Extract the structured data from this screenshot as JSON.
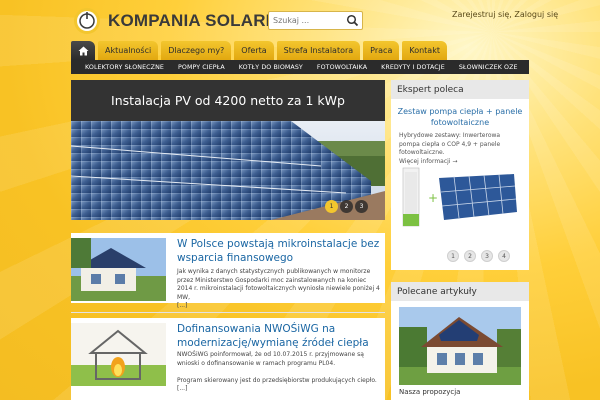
{
  "brand": {
    "name": "KOMPANIA SOLARNA",
    "accent": "#f3c62e"
  },
  "search": {
    "placeholder": "Szukaj ..."
  },
  "account": {
    "register": "Zarejestruj się,",
    "login": "Zaloguj się"
  },
  "nav": {
    "home_icon": "home-icon",
    "tabs": [
      "Aktualności",
      "Dlaczego my?",
      "Oferta",
      "Strefa Instalatora",
      "Praca",
      "Kontakt"
    ]
  },
  "subnav": [
    "Kolektory słoneczne",
    "Pompy ciepła",
    "Kotły do biomasy",
    "Fotowoltaika",
    "Kredyty i dotacje",
    "Słowniczek OZE"
  ],
  "slider": {
    "title": "Instalacja PV od 4200 netto za 1 kWp",
    "dots": [
      "1",
      "2",
      "3"
    ],
    "active": 0
  },
  "articles": [
    {
      "title": "W Polsce powstają mikroinstalacje bez wsparcia finansowego",
      "body": "Jak wynika z danych statystycznych publikowanych w monitorze przez Ministerstwo Gospodarki moc zainstalowanych na koniec 2014 r. mikroinstalacji fotowoltaicznych wyniosła niewiele poniżej 4 MW,",
      "more": "[...]"
    },
    {
      "title": "Dofinansowania NWOŚiWG na modernizację/wymianę źródeł ciepła",
      "body1": "NWOŚiWG poinformował, że od 10.07.2015 r. przyjmowane są wnioski o dofinansowanie w ramach programu PL04.",
      "body2": "Program skierowany jest do przedsiębiorstw produkujących ciepło.",
      "more": "[...]"
    }
  ],
  "expert": {
    "heading": "Ekspert poleca",
    "title": "Zestaw pompa ciepła + panele fotowoltaiczne",
    "text": "Hybrydowe zestawy: Inwerterowa pompa ciepła o COP 4,9 + panele fotowoltaiczne.",
    "more": "Więcej informacji →",
    "dots": [
      "1",
      "2",
      "3",
      "4"
    ]
  },
  "polecane": {
    "heading": "Polecane artykuły",
    "caption": "Nasza propozycja"
  }
}
